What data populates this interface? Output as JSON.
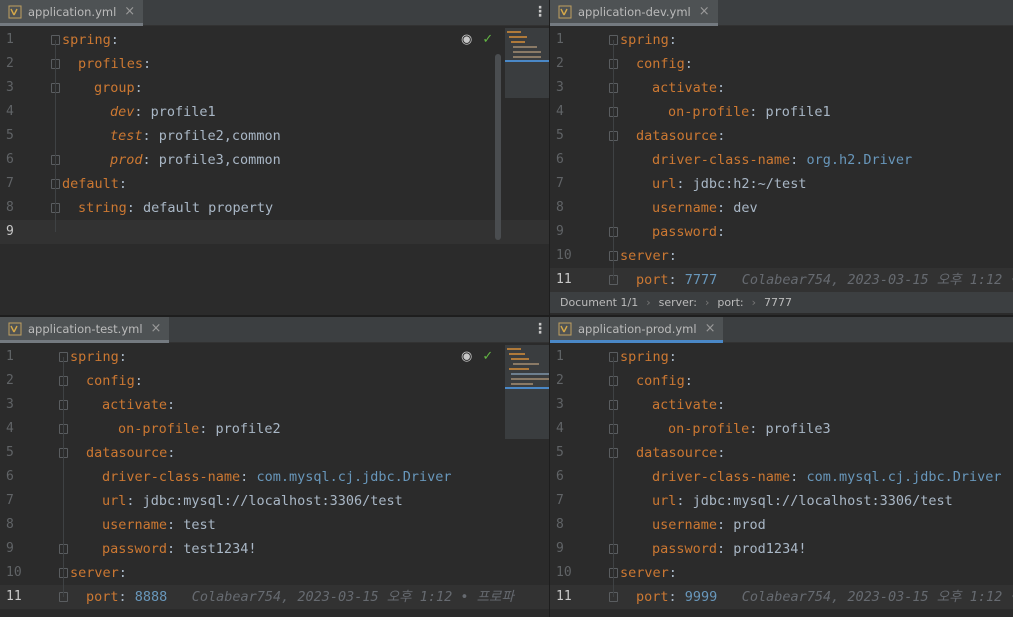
{
  "colors": {
    "key": "#cc7832",
    "value": "#a9b7c6",
    "class_ref": "#6897bb",
    "number": "#6897bb",
    "hint": "#666a70",
    "accent_tab": "#4a88c7"
  },
  "panes": {
    "tl": {
      "tab": "application.yml",
      "close": "×",
      "menu": "⋮",
      "eye": "◉",
      "check": "✓",
      "lines": [
        {
          "n": "1",
          "indent": 0,
          "key": "spring",
          "italic": false,
          "sep": ":",
          "val": ""
        },
        {
          "n": "2",
          "indent": 1,
          "key": "profiles",
          "italic": false,
          "sep": ":",
          "val": ""
        },
        {
          "n": "3",
          "indent": 2,
          "key": "group",
          "italic": false,
          "sep": ":",
          "val": ""
        },
        {
          "n": "4",
          "indent": 3,
          "key": "dev",
          "italic": true,
          "sep": ": ",
          "val": "profile1"
        },
        {
          "n": "5",
          "indent": 3,
          "key": "test",
          "italic": true,
          "sep": ": ",
          "val": "profile2,common"
        },
        {
          "n": "6",
          "indent": 3,
          "key": "prod",
          "italic": true,
          "sep": ": ",
          "val": "profile3,common"
        },
        {
          "n": "7",
          "indent": 0,
          "key": "default",
          "italic": false,
          "sep": ":",
          "val": ""
        },
        {
          "n": "8",
          "indent": 1,
          "key": "string",
          "italic": false,
          "sep": ": ",
          "val": "default property"
        },
        {
          "n": "9",
          "indent": 0,
          "key": "",
          "italic": false,
          "sep": "",
          "val": ""
        }
      ]
    },
    "tr": {
      "tab": "application-dev.yml",
      "close": "×",
      "lines": [
        {
          "n": "1",
          "indent": 0,
          "key": "spring",
          "sep": ":",
          "val": ""
        },
        {
          "n": "2",
          "indent": 1,
          "key": "config",
          "sep": ":",
          "val": ""
        },
        {
          "n": "3",
          "indent": 2,
          "key": "activate",
          "sep": ":",
          "val": ""
        },
        {
          "n": "4",
          "indent": 3,
          "key": "on-profile",
          "sep": ": ",
          "val": "profile1"
        },
        {
          "n": "5",
          "indent": 1,
          "key": "datasource",
          "sep": ":",
          "val": ""
        },
        {
          "n": "6",
          "indent": 2,
          "key": "driver-class-name",
          "sep": ": ",
          "val": "org.h2.Driver",
          "cls": true
        },
        {
          "n": "7",
          "indent": 2,
          "key": "url",
          "sep": ": ",
          "val": "jdbc:h2:~/test"
        },
        {
          "n": "8",
          "indent": 2,
          "key": "username",
          "sep": ": ",
          "val": "dev"
        },
        {
          "n": "9",
          "indent": 2,
          "key": "password",
          "sep": ":",
          "val": ""
        },
        {
          "n": "10",
          "indent": 0,
          "key": "server",
          "sep": ":",
          "val": ""
        },
        {
          "n": "11",
          "indent": 1,
          "key": "port",
          "sep": ": ",
          "val": "7777",
          "num": true,
          "hint": "Colabear754, 2023-03-15 오후 1:12 •"
        }
      ],
      "breadcrumb": [
        "Document 1/1",
        "server:",
        "port:",
        "7777"
      ]
    },
    "bl": {
      "tab": "application-test.yml",
      "close": "×",
      "menu": "⋮",
      "eye": "◉",
      "check": "✓",
      "lines": [
        {
          "n": "1",
          "indent": 0,
          "key": "spring",
          "sep": ":",
          "val": ""
        },
        {
          "n": "2",
          "indent": 1,
          "key": "config",
          "sep": ":",
          "val": ""
        },
        {
          "n": "3",
          "indent": 2,
          "key": "activate",
          "sep": ":",
          "val": ""
        },
        {
          "n": "4",
          "indent": 3,
          "key": "on-profile",
          "sep": ": ",
          "val": "profile2"
        },
        {
          "n": "5",
          "indent": 1,
          "key": "datasource",
          "sep": ":",
          "val": ""
        },
        {
          "n": "6",
          "indent": 2,
          "key": "driver-class-name",
          "sep": ": ",
          "val": "com.mysql.cj.jdbc.Driver",
          "cls": true
        },
        {
          "n": "7",
          "indent": 2,
          "key": "url",
          "sep": ": ",
          "val": "jdbc:mysql://localhost:3306/test"
        },
        {
          "n": "8",
          "indent": 2,
          "key": "username",
          "sep": ": ",
          "val": "test"
        },
        {
          "n": "9",
          "indent": 2,
          "key": "password",
          "sep": ": ",
          "val": "test1234!"
        },
        {
          "n": "10",
          "indent": 0,
          "key": "server",
          "sep": ":",
          "val": ""
        },
        {
          "n": "11",
          "indent": 1,
          "key": "port",
          "sep": ": ",
          "val": "8888",
          "num": true,
          "hint": "Colabear754, 2023-03-15 오후 1:12 • 프로파"
        }
      ]
    },
    "br": {
      "tab": "application-prod.yml",
      "close": "×",
      "lines": [
        {
          "n": "1",
          "indent": 0,
          "key": "spring",
          "sep": ":",
          "val": ""
        },
        {
          "n": "2",
          "indent": 1,
          "key": "config",
          "sep": ":",
          "val": ""
        },
        {
          "n": "3",
          "indent": 2,
          "key": "activate",
          "sep": ":",
          "val": ""
        },
        {
          "n": "4",
          "indent": 3,
          "key": "on-profile",
          "sep": ": ",
          "val": "profile3"
        },
        {
          "n": "5",
          "indent": 1,
          "key": "datasource",
          "sep": ":",
          "val": ""
        },
        {
          "n": "6",
          "indent": 2,
          "key": "driver-class-name",
          "sep": ": ",
          "val": "com.mysql.cj.jdbc.Driver",
          "cls": true
        },
        {
          "n": "7",
          "indent": 2,
          "key": "url",
          "sep": ": ",
          "val": "jdbc:mysql://localhost:3306/test"
        },
        {
          "n": "8",
          "indent": 2,
          "key": "username",
          "sep": ": ",
          "val": "prod"
        },
        {
          "n": "9",
          "indent": 2,
          "key": "password",
          "sep": ": ",
          "val": "prod1234!"
        },
        {
          "n": "10",
          "indent": 0,
          "key": "server",
          "sep": ":",
          "val": ""
        },
        {
          "n": "11",
          "indent": 1,
          "key": "port",
          "sep": ": ",
          "val": "9999",
          "num": true,
          "hint": "Colabear754, 2023-03-15 오후 1:12 •"
        }
      ]
    }
  }
}
